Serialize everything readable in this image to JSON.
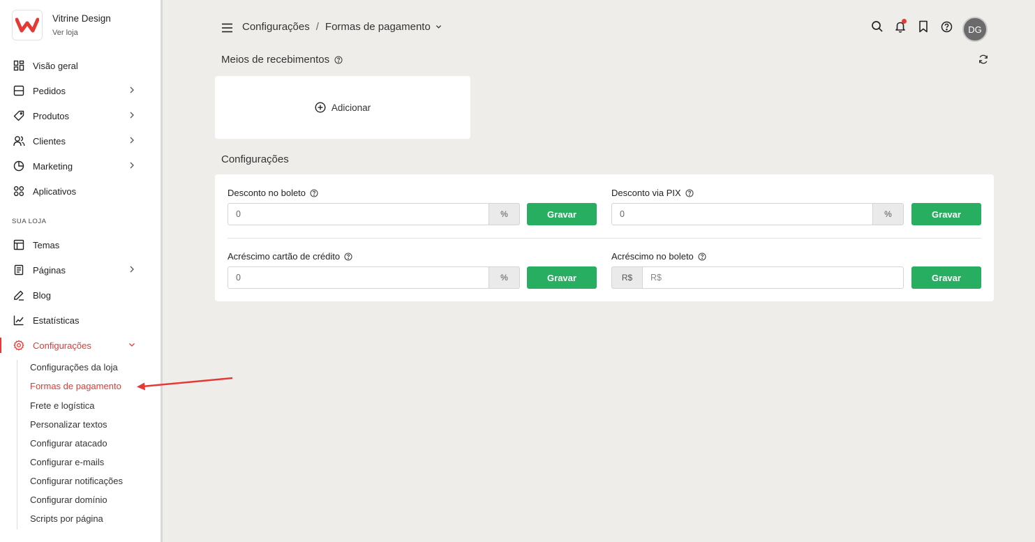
{
  "brand": {
    "name": "Vitrine Design",
    "link": "Ver loja",
    "logo_letter": "W",
    "logo_color": "#e53935"
  },
  "nav": {
    "items": [
      {
        "label": "Visão geral",
        "icon": "dashboard-icon"
      },
      {
        "label": "Pedidos",
        "icon": "orders-icon"
      },
      {
        "label": "Produtos",
        "icon": "tag-icon"
      },
      {
        "label": "Clientes",
        "icon": "users-icon"
      },
      {
        "label": "Marketing",
        "icon": "pie-chart-icon"
      },
      {
        "label": "Aplicativos",
        "icon": "apps-icon"
      }
    ],
    "section_title": "SUA LOJA",
    "store_items": [
      {
        "label": "Temas",
        "icon": "layout-icon"
      },
      {
        "label": "Páginas",
        "icon": "page-icon"
      },
      {
        "label": "Blog",
        "icon": "pen-icon"
      },
      {
        "label": "Estatísticas",
        "icon": "line-chart-icon"
      },
      {
        "label": "Configurações",
        "icon": "gear-icon"
      }
    ],
    "sub_items": [
      "Configurações da loja",
      "Formas de pagamento",
      "Frete e logística",
      "Personalizar textos",
      "Configurar atacado",
      "Configurar e-mails",
      "Configurar notificações",
      "Configurar domínio",
      "Scripts por página"
    ]
  },
  "header": {
    "breadcrumb_root": "Configurações",
    "breadcrumb_sep": "/",
    "breadcrumb_current": "Formas de pagamento",
    "avatar_initials": "DG"
  },
  "receiving": {
    "title": "Meios de recebimentos",
    "add_label": "Adicionar"
  },
  "settings": {
    "title": "Configurações",
    "fields": [
      {
        "label": "Desconto no boleto",
        "value": "0",
        "addon": "%",
        "button": "Gravar"
      },
      {
        "label": "Desconto via PIX",
        "value": "0",
        "addon": "%",
        "button": "Gravar"
      },
      {
        "label": "Acréscimo cartão de crédito",
        "value": "0",
        "addon": "%",
        "button": "Gravar"
      },
      {
        "label": "Acréscimo no boleto",
        "placeholder": "R$",
        "addon": "R$",
        "button": "Gravar"
      }
    ]
  },
  "colors": {
    "accent": "#e53935",
    "button": "#27ae60",
    "background": "#efedea"
  }
}
